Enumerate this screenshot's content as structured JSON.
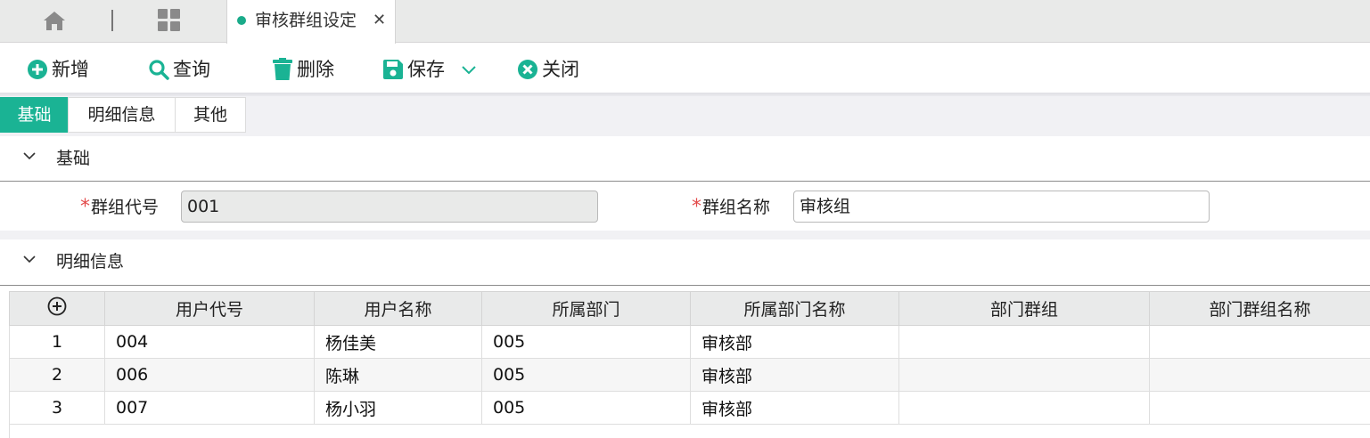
{
  "tabbar": {
    "home_icon": "home-icon",
    "apps_icon": "apps-grid-icon",
    "active_tab": {
      "label": "审核群组设定",
      "close": "✕",
      "dot_color": "#1aab8a"
    }
  },
  "toolbar": {
    "add": "新增",
    "query": "查询",
    "delete": "删除",
    "save": "保存",
    "close": "关闭",
    "icon_color": "#1ab394"
  },
  "section_tabs": [
    "基础",
    "明细信息",
    "其他"
  ],
  "basic_section": {
    "title": "基础",
    "group_code_label": "群组代号",
    "group_code_value": "001",
    "group_name_label": "群组名称",
    "group_name_value": "审核组"
  },
  "detail_section": {
    "title": "明细信息",
    "columns": [
      "用户代号",
      "用户名称",
      "所属部门",
      "所属部门名称",
      "部门群组",
      "部门群组名称"
    ],
    "rows": [
      {
        "idx": "1",
        "user_code": "004",
        "user_name": "杨佳美",
        "dept": "005",
        "dept_name": "审核部",
        "dept_group": "",
        "dept_group_name": ""
      },
      {
        "idx": "2",
        "user_code": "006",
        "user_name": "陈琳",
        "dept": "005",
        "dept_name": "审核部",
        "dept_group": "",
        "dept_group_name": ""
      },
      {
        "idx": "3",
        "user_code": "007",
        "user_name": "杨小羽",
        "dept": "005",
        "dept_name": "审核部",
        "dept_group": "",
        "dept_group_name": ""
      }
    ]
  }
}
